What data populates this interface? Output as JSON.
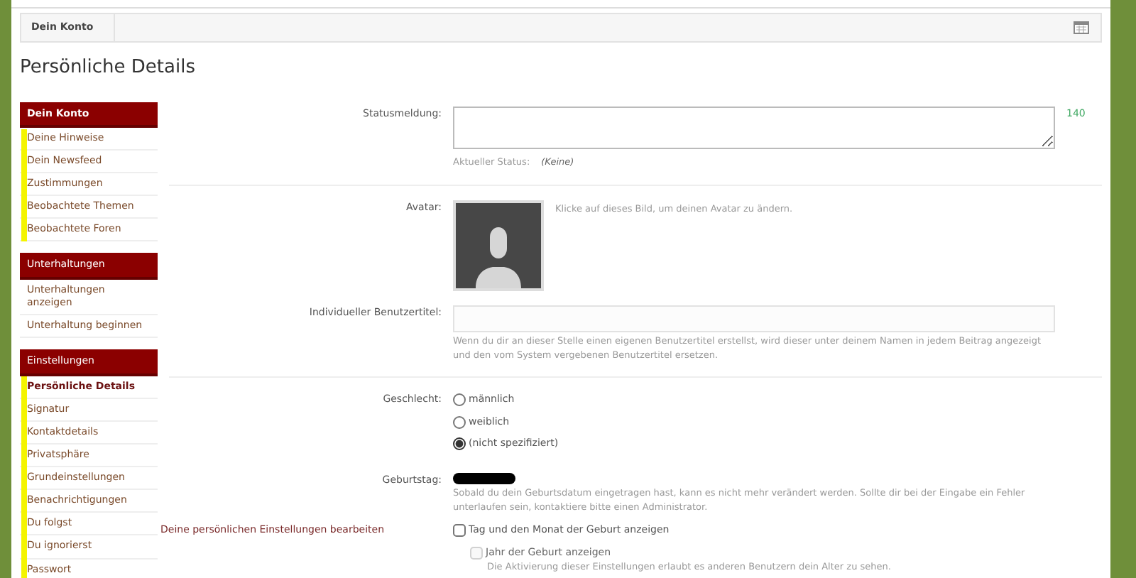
{
  "breadcrumb": [
    {
      "label": "Dein Konto"
    }
  ],
  "page_title": "Persönliche Details",
  "sidebar": [
    {
      "title": "Dein Konto",
      "bold": true,
      "highlighted": true,
      "items": [
        {
          "label": "Deine Hinweise",
          "selected": false
        },
        {
          "label": "Dein Newsfeed",
          "selected": false
        },
        {
          "label": "Zustimmungen",
          "selected": false
        },
        {
          "label": "Beobachtete Themen",
          "selected": false
        },
        {
          "label": "Beobachtete Foren",
          "selected": false
        }
      ]
    },
    {
      "title": "Unterhaltungen",
      "bold": false,
      "highlighted": false,
      "items": [
        {
          "label": "Unterhaltungen anzeigen",
          "selected": false
        },
        {
          "label": "Unterhaltung beginnen",
          "selected": false
        }
      ]
    },
    {
      "title": "Einstellungen",
      "bold": false,
      "highlighted": true,
      "items": [
        {
          "label": "Persönliche Details",
          "selected": true
        },
        {
          "label": "Signatur",
          "selected": false
        },
        {
          "label": "Kontaktdetails",
          "selected": false
        },
        {
          "label": "Privatsphäre",
          "selected": false
        },
        {
          "label": "Grundeinstellungen",
          "selected": false
        },
        {
          "label": "Benachrichtigungen",
          "selected": false
        },
        {
          "label": "Du folgst",
          "selected": false
        },
        {
          "label": "Du ignorierst",
          "selected": false
        },
        {
          "label": "Passwort",
          "selected": false
        }
      ]
    }
  ],
  "form": {
    "status": {
      "label": "Statusmeldung:",
      "counter": "140",
      "current_label": "Aktueller Status:",
      "current_value": "(Keine)"
    },
    "avatar": {
      "label": "Avatar:",
      "hint": "Klicke auf dieses Bild, um deinen Avatar zu ändern."
    },
    "custom_title": {
      "label": "Individueller Benutzertitel:",
      "hint": "Wenn du dir an dieser Stelle einen eigenen Benutzertitel erstellst, wird dieser unter deinem Namen in jedem Beitrag angezeigt und den vom System vergebenen Benutzertitel ersetzen."
    },
    "gender": {
      "label": "Geschlecht:",
      "options": [
        {
          "label": "männlich",
          "selected": false
        },
        {
          "label": "weiblich",
          "selected": false
        },
        {
          "label": "(nicht spezifiziert)",
          "selected": true
        }
      ]
    },
    "birthday": {
      "label": "Geburtstag:",
      "hint": "Sobald du dein Geburtsdatum eingetragen hast, kann es nicht mehr verändert werden. Sollte dir bei der Eingabe ein Fehler unterlaufen sein, kontaktiere bitte einen Administrator."
    },
    "privacy": {
      "label": "Deine persönlichen Einstellungen bearbeiten",
      "options": [
        {
          "label": "Tag und den Monat der Geburt anzeigen",
          "checked": false,
          "disabled": false,
          "children": [
            {
              "label": "Jahr der Geburt anzeigen",
              "checked": false,
              "disabled": true
            }
          ]
        }
      ],
      "hint": "Die Aktivierung dieser Einstellungen erlaubt es anderen Benutzern dein Alter zu sehen."
    }
  }
}
